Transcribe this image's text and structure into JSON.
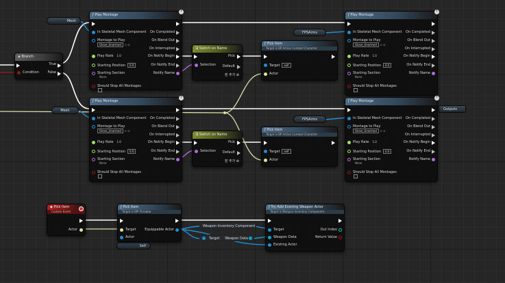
{
  "graph": {
    "colors": {
      "exec": "#ffffff",
      "object": "#1f8fd6",
      "struct": "#0aa6c9",
      "name": "#b36ad9",
      "bool": "#8c1a1a",
      "float": "#9ee05a",
      "green_wire": "#d7e6a9"
    }
  },
  "variables": {
    "mesh_top": "Mesh",
    "mesh_bottom": "Mesh",
    "fpsarms_top": "FPSArms",
    "fpsarms_bottom": "FPSArms",
    "outputs": "Outputs",
    "self": "Self"
  },
  "branch": {
    "title": "Branch",
    "true_label": "True",
    "false_label": "False",
    "condition_label": "Condition"
  },
  "play_montage": {
    "title": "Play Montage",
    "badge": "f",
    "in_mesh": "In Skeletal Mesh Component",
    "montage_to_play": "Montage to Play",
    "montage_value": "Glove_Unarmed",
    "play_rate": "Play Rate",
    "play_rate_value": "1.0",
    "starting_position": "Starting Position",
    "starting_position_value": "0.0",
    "starting_section": "Starting Section",
    "starting_section_value": "None",
    "should_stop": "Should Stop All Montages",
    "on_completed": "On Completed",
    "on_blend_out": "On Blend Out",
    "on_interrupted": "On Interrupted",
    "on_notify_begin": "On Notify Begin",
    "on_notify_end": "On Notify End",
    "notify_name": "Notify Name"
  },
  "switch_on_name": {
    "title": "Switch on Name",
    "selection": "Selection",
    "pick": "Pick",
    "default": "Default",
    "add_pin": "핀 추가"
  },
  "pick_item_combat": {
    "title": "Pick Item",
    "subtitle": "Target is BP Action Combat Character",
    "target": "Target",
    "target_value": "self",
    "actor": "Actor"
  },
  "pick_item_event": {
    "title": "Pick Item",
    "subtitle": "Custom Event",
    "actor": "Actor"
  },
  "pick_item_pickable": {
    "title": "Pick Item",
    "subtitle": "Target is BPI Pickable",
    "target": "Target",
    "actor": "Actor",
    "equippable_actor": "Equippable Actor"
  },
  "weapon_getters": {
    "weapon_inventory_component": "Weapon Inventory Component",
    "target": "Target",
    "weapon_data": "Weapon Data"
  },
  "try_add_weapon": {
    "title": "Try Add Existing Weapon Actor",
    "subtitle": "Target is Weapon Inventory Component",
    "target": "Target",
    "weapon_data": "Weapon Data",
    "existing_actor": "Existing Actor",
    "out_index": "Out Index",
    "return_value": "Return Value"
  }
}
